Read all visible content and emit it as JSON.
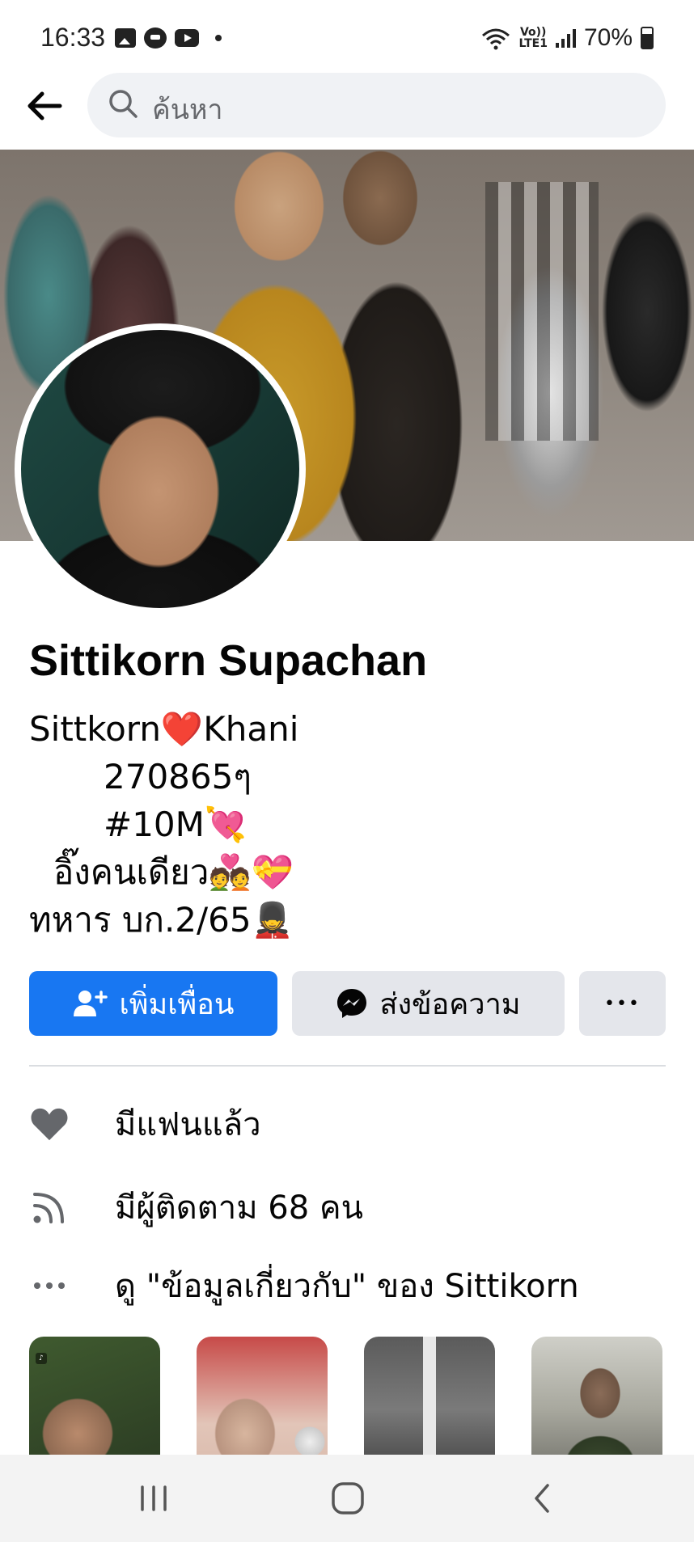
{
  "status_bar": {
    "time": "16:33",
    "network_label": "LTE1",
    "volte_label": "Vo))",
    "battery": "70%",
    "notification_icons": [
      "gallery-icon",
      "line-icon",
      "youtube-icon"
    ]
  },
  "search": {
    "placeholder": "ค้นหา"
  },
  "profile": {
    "name": "Sittikorn Supachan",
    "bio_lines": [
      "Sittkorn❤️Khani",
      "270865ๆ",
      "#10M💘",
      "อิ๊งคนเดียว💑💝",
      "ทหาร บก.2/65💂"
    ]
  },
  "actions": {
    "add_friend": "เพิ่มเพื่อน",
    "message": "ส่งข้อความ",
    "more": "•••"
  },
  "info": {
    "relationship": "มีแฟนแล้ว",
    "followers": "มีผู้ติดตาม 68 คน",
    "about": "ดู \"ข้อมูลเกี่ยวกับ\" ของ Sittikorn"
  },
  "colors": {
    "primary": "#1877f2",
    "secondary_button": "#e4e6eb",
    "icon_gray": "#65676b",
    "divider": "#dadde1"
  }
}
